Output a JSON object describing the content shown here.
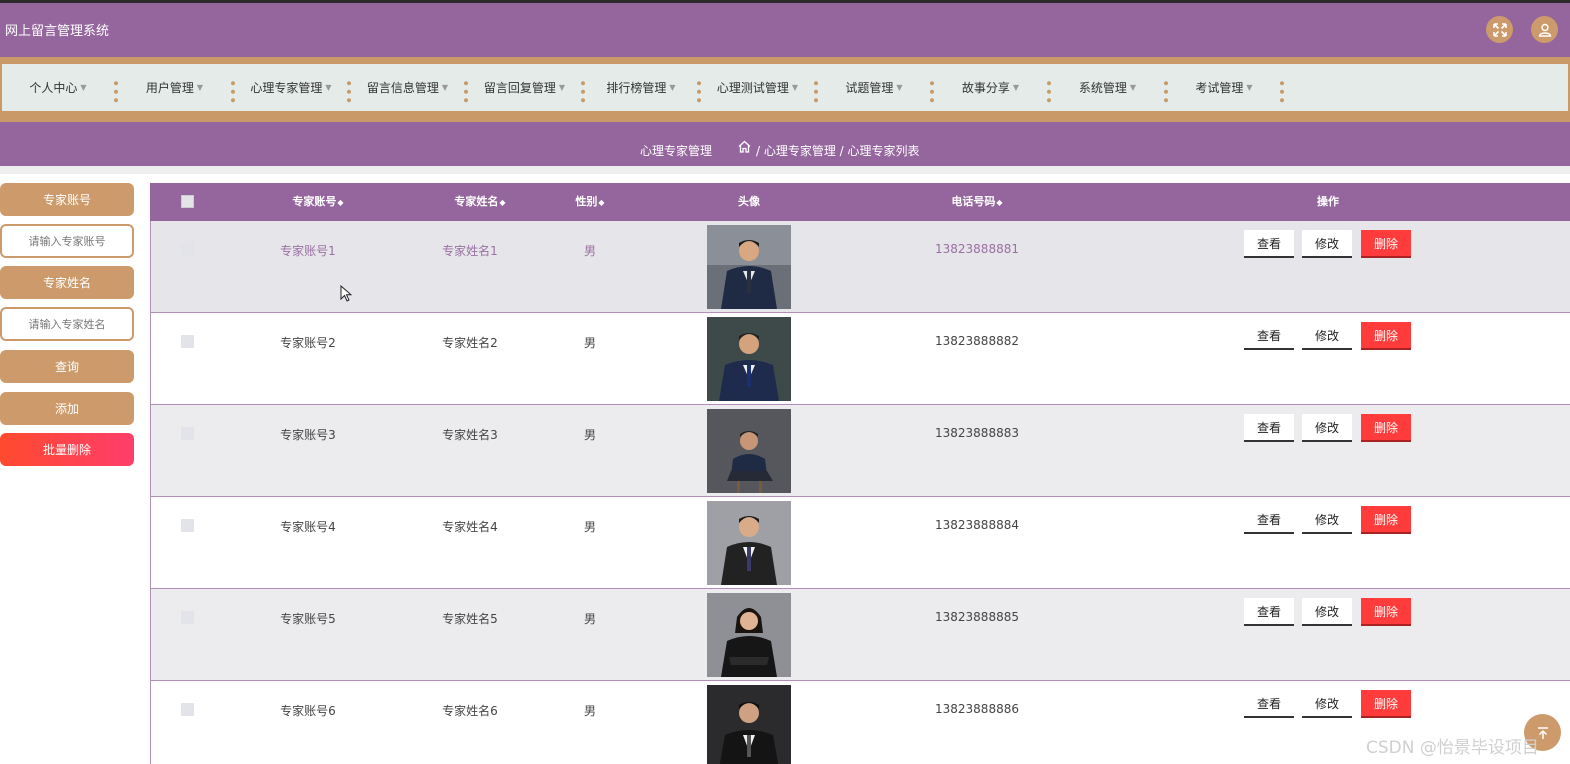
{
  "app": {
    "title": "网上留言管理系统"
  },
  "header": {
    "fullscreen_icon": "expand-icon",
    "user_icon": "user-icon"
  },
  "nav": {
    "items": [
      {
        "label": "个人中心"
      },
      {
        "label": "用户管理"
      },
      {
        "label": "心理专家管理"
      },
      {
        "label": "留言信息管理"
      },
      {
        "label": "留言回复管理"
      },
      {
        "label": "排行榜管理"
      },
      {
        "label": "心理测试管理"
      },
      {
        "label": "试题管理"
      },
      {
        "label": "故事分享"
      },
      {
        "label": "系统管理"
      },
      {
        "label": "考试管理"
      }
    ]
  },
  "breadcrumb": {
    "title": "心理专家管理",
    "home_icon": "home-icon",
    "path": "/ 心理专家管理 / 心理专家列表"
  },
  "search": {
    "account_label": "专家账号",
    "account_placeholder": "请输入专家账号",
    "name_label": "专家姓名",
    "name_placeholder": "请输入专家姓名",
    "query_label": "查询",
    "add_label": "添加",
    "batch_delete_label": "批量删除"
  },
  "table": {
    "columns": {
      "account": "专家账号",
      "name": "专家姓名",
      "gender": "性别",
      "avatar": "头像",
      "phone": "电话号码",
      "actions": "操作"
    },
    "sort_icon": "◆",
    "rows": [
      {
        "account": "专家账号1",
        "name": "专家姓名1",
        "gender": "男",
        "phone": "13823888881"
      },
      {
        "account": "专家账号2",
        "name": "专家姓名2",
        "gender": "男",
        "phone": "13823888882"
      },
      {
        "account": "专家账号3",
        "name": "专家姓名3",
        "gender": "男",
        "phone": "13823888883"
      },
      {
        "account": "专家账号4",
        "name": "专家姓名4",
        "gender": "男",
        "phone": "13823888884"
      },
      {
        "account": "专家账号5",
        "name": "专家姓名5",
        "gender": "男",
        "phone": "13823888885"
      },
      {
        "account": "专家账号6",
        "name": "专家姓名6",
        "gender": "男",
        "phone": "13823888886"
      }
    ],
    "actions": {
      "view": "查看",
      "edit": "修改",
      "delete": "删除"
    }
  },
  "watermark": "CSDN @怡景毕设项目",
  "colors": {
    "primary": "#95669e",
    "accent": "#cd9b6b",
    "danger": "#ff3b3b"
  }
}
